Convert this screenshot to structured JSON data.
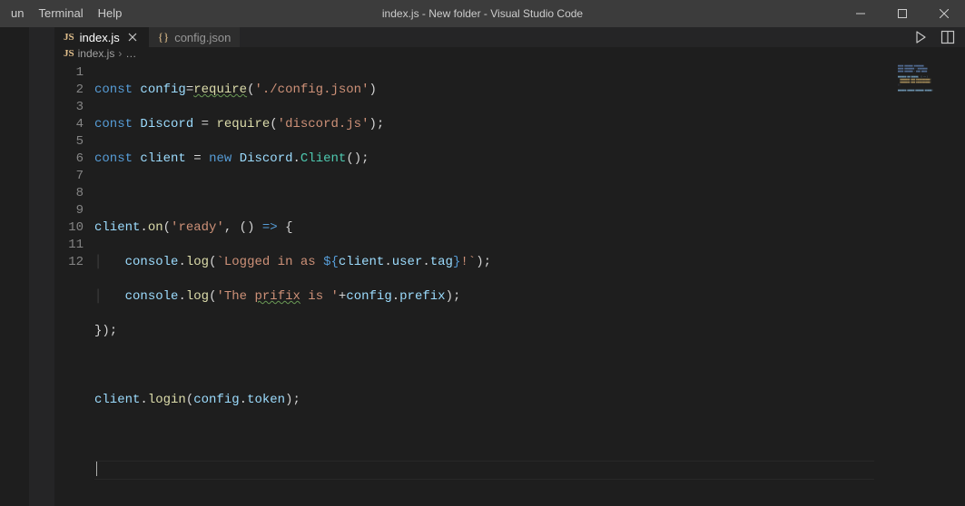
{
  "menu": {
    "items": [
      "un",
      "Terminal",
      "Help"
    ]
  },
  "title": "index.js - New folder - Visual Studio Code",
  "tabs": [
    {
      "icon": "JS",
      "label": "index.js",
      "active": true,
      "dirty": false
    },
    {
      "icon": "{}",
      "label": "config.json",
      "active": false,
      "dirty": false
    }
  ],
  "breadcrumb": {
    "icon": "JS",
    "file": "index.js",
    "rest": "…"
  },
  "gutter": [
    "1",
    "2",
    "3",
    "4",
    "5",
    "6",
    "7",
    "8",
    "9",
    "10",
    "11",
    "12"
  ],
  "code": {
    "l1": {
      "a": "const",
      "b": "config",
      "c": "=",
      "d": "require",
      "e": "(",
      "f": "'./config.json'",
      "g": ")"
    },
    "l2": {
      "a": "const",
      "b": "Discord",
      "c": " = ",
      "d": "require",
      "e": "(",
      "f": "'discord.js'",
      "g": ");"
    },
    "l3": {
      "a": "const",
      "b": "client",
      "c": " = ",
      "d": "new",
      "e": "Discord",
      "f": ".",
      "g": "Client",
      "h": "();"
    },
    "l5": {
      "a": "client",
      "b": ".",
      "c": "on",
      "d": "(",
      "e": "'ready'",
      "f": ", () ",
      "g": "=>",
      "h": " {"
    },
    "l6": {
      "a": "    ",
      "b": "console",
      "c": ".",
      "d": "log",
      "e": "(",
      "f": "`Logged in as ",
      "g": "${",
      "h": "client",
      "i": ".",
      "j": "user",
      "k": ".",
      "l": "tag",
      "m": "}",
      "n": "!`",
      "o": ");"
    },
    "l7": {
      "a": "    ",
      "b": "console",
      "c": ".",
      "d": "log",
      "e": "(",
      "f": "'The ",
      "g": "prifix",
      "h": " is '",
      "i": "+",
      "j": "config",
      "k": ".",
      "l": "prefix",
      "m": ");"
    },
    "l8": {
      "a": "});"
    },
    "l10": {
      "a": "client",
      "b": ".",
      "c": "login",
      "d": "(",
      "e": "config",
      "f": ".",
      "g": "token",
      "h": ");"
    }
  }
}
